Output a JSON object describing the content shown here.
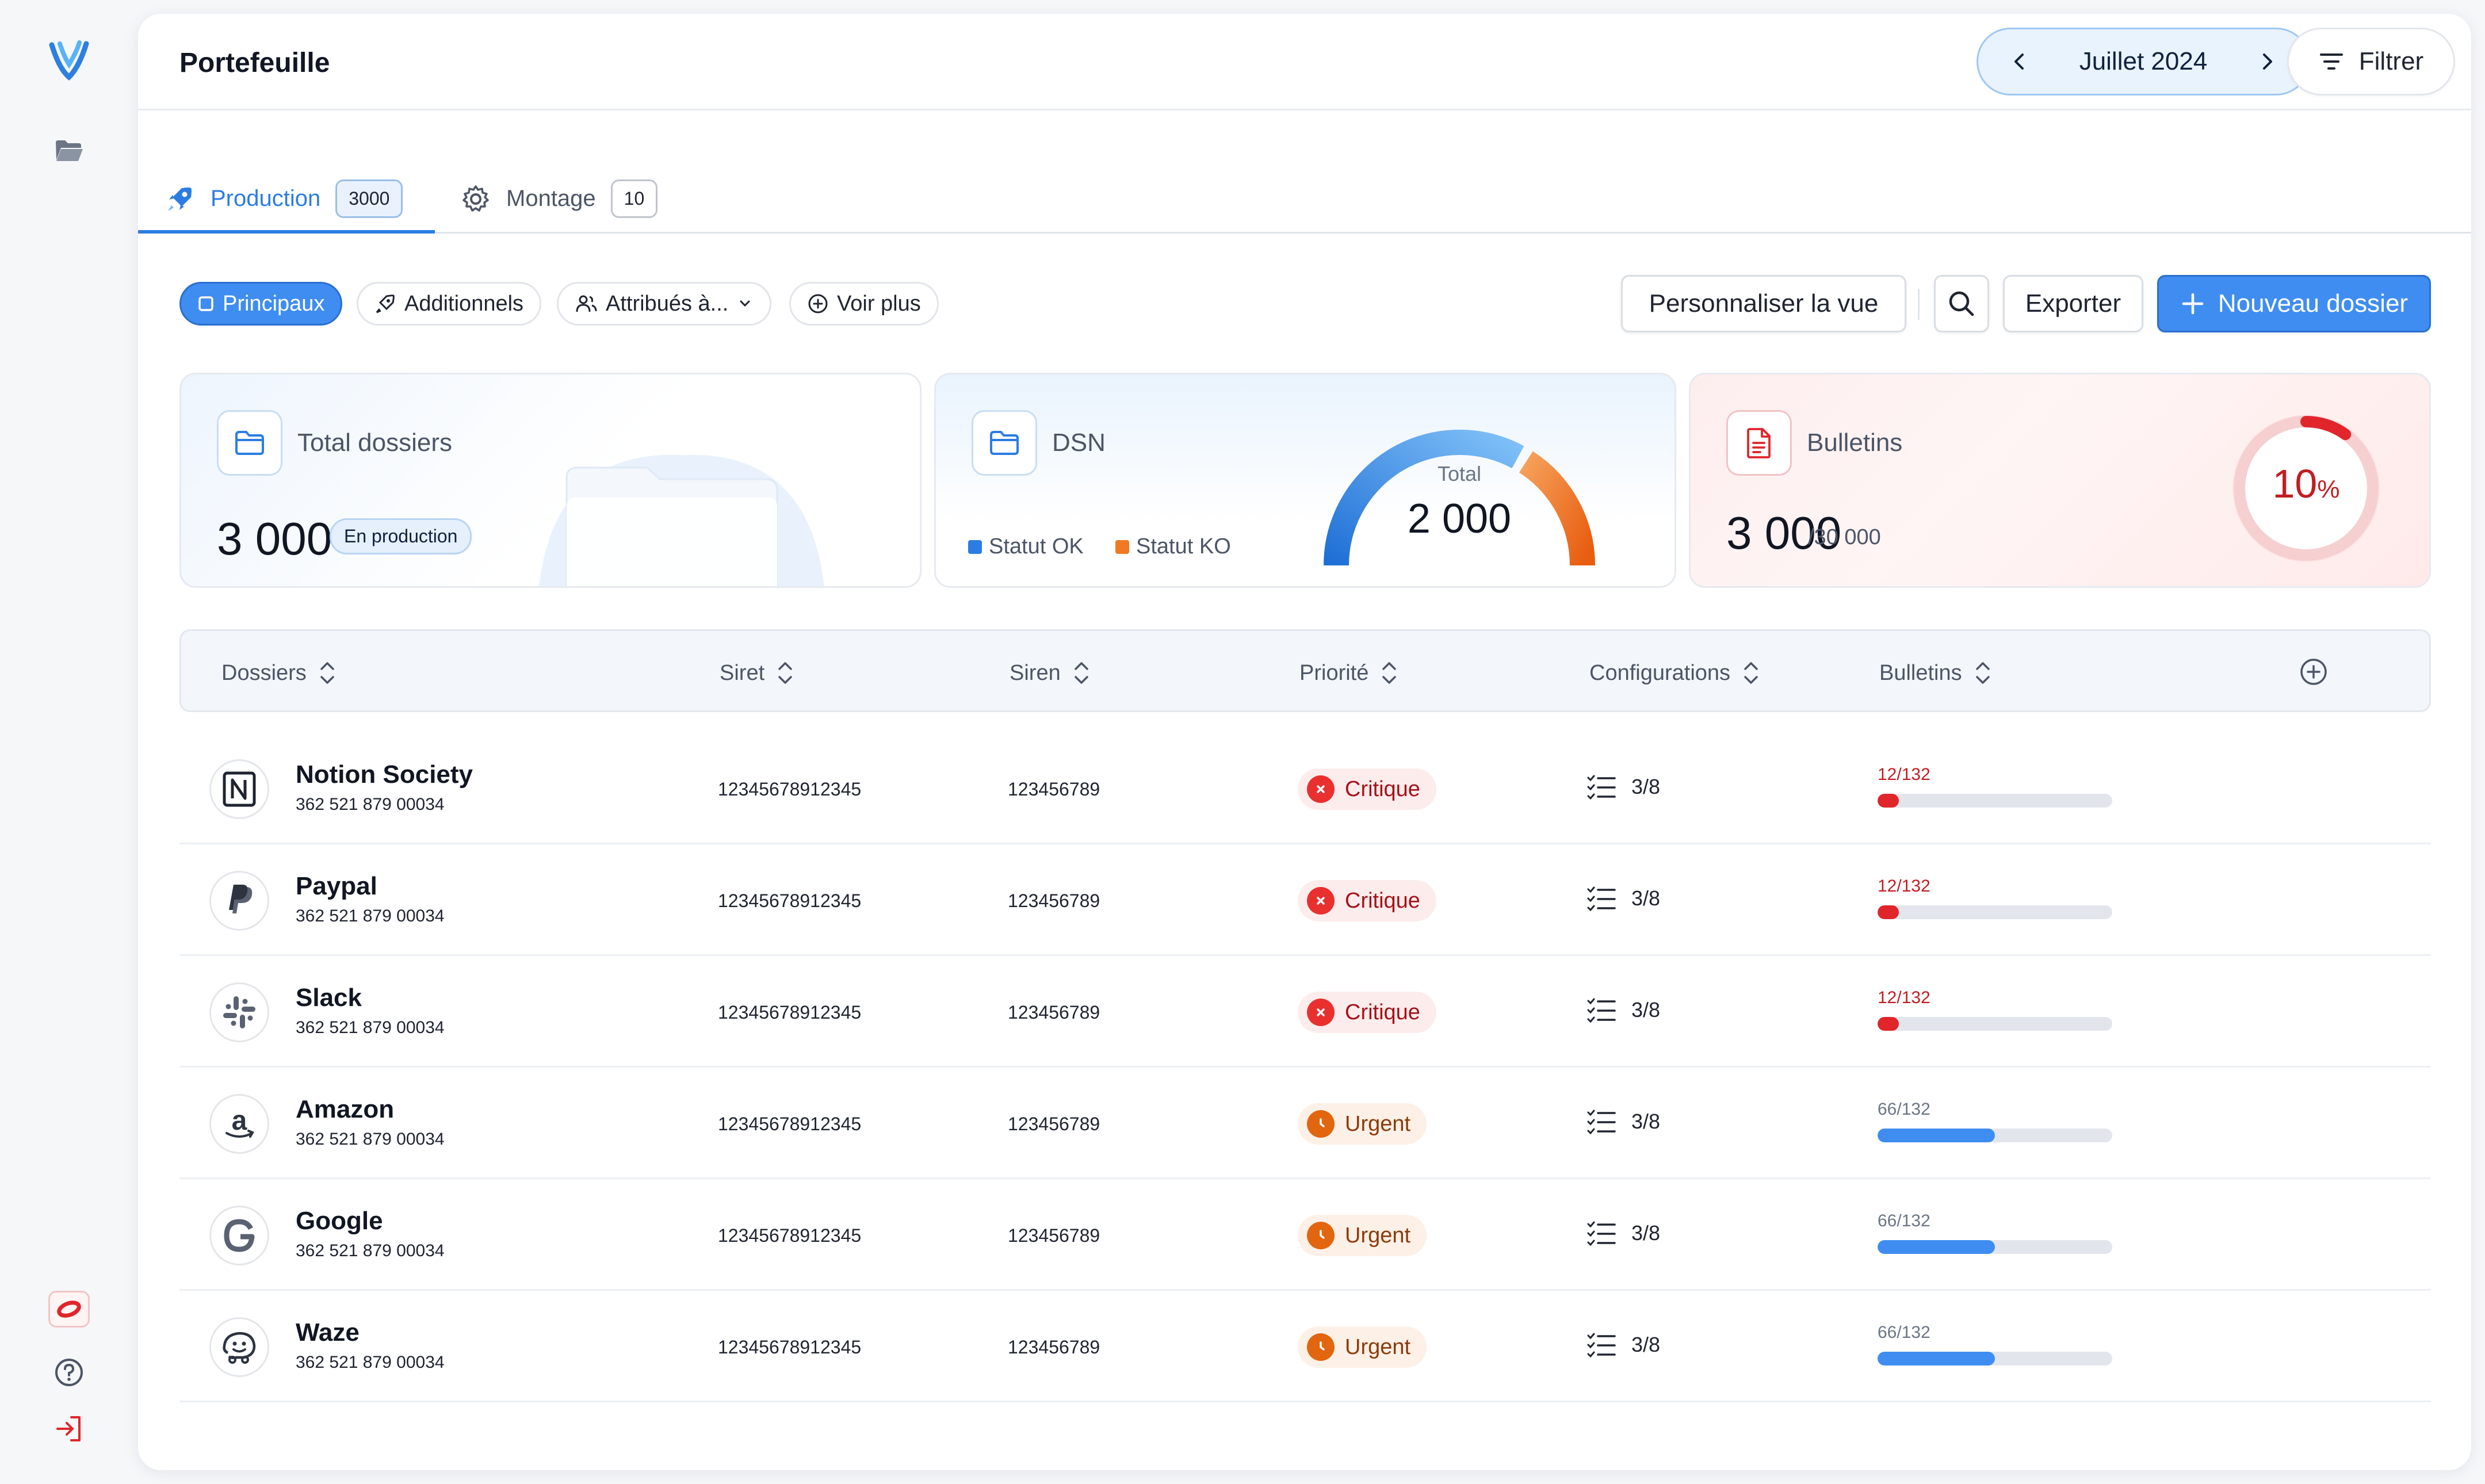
{
  "app": {
    "title": "Portefeuille"
  },
  "period": {
    "label": "Juillet 2024"
  },
  "filter_label": "Filtrer",
  "tabs": [
    {
      "label": "Production",
      "count": "3000"
    },
    {
      "label": "Montage",
      "count": "10"
    }
  ],
  "chips": {
    "principaux": "Principaux",
    "additionnels": "Additionnels",
    "attribues": "Attribués à...",
    "voir_plus": "Voir plus"
  },
  "actions": {
    "personnaliser": "Personnaliser la vue",
    "exporter": "Exporter",
    "nouveau": "Nouveau dossier"
  },
  "stats": {
    "total": {
      "title": "Total dossiers",
      "value": "3 000",
      "tag": "En production"
    },
    "dsn": {
      "title": "DSN",
      "legend_ok": "Statut OK",
      "legend_ko": "Statut KO",
      "gauge_label": "Total",
      "gauge_value": "2 000",
      "ok_fraction": 0.67
    },
    "bulletins": {
      "title": "Bulletins",
      "value": "3 000",
      "of": "/30 000",
      "percent": "10",
      "percent_sign": "%",
      "fraction": 0.1
    }
  },
  "table": {
    "headers": [
      "Dossiers",
      "Siret",
      "Siren",
      "Priorité",
      "Configurations",
      "Bulletins"
    ],
    "rows": [
      {
        "name": "Notion Society",
        "sub": "362 521 879 00034",
        "siret": "12345678912345",
        "siren": "123456789",
        "priority": "Critique",
        "level": "crit",
        "config": "3/8",
        "bulletins": "12/132",
        "done": 12,
        "total": 132,
        "logo": "N"
      },
      {
        "name": "Paypal",
        "sub": "362 521 879 00034",
        "siret": "12345678912345",
        "siren": "123456789",
        "priority": "Critique",
        "level": "crit",
        "config": "3/8",
        "bulletins": "12/132",
        "done": 12,
        "total": 132,
        "logo": "P"
      },
      {
        "name": "Slack",
        "sub": "362 521 879 00034",
        "siret": "12345678912345",
        "siren": "123456789",
        "priority": "Critique",
        "level": "crit",
        "config": "3/8",
        "bulletins": "12/132",
        "done": 12,
        "total": 132,
        "logo": "#"
      },
      {
        "name": "Amazon",
        "sub": "362 521 879 00034",
        "siret": "12345678912345",
        "siren": "123456789",
        "priority": "Urgent",
        "level": "urg",
        "config": "3/8",
        "bulletins": "66/132",
        "done": 66,
        "total": 132,
        "logo": "a"
      },
      {
        "name": "Google",
        "sub": "362 521 879 00034",
        "siret": "12345678912345",
        "siren": "123456789",
        "priority": "Urgent",
        "level": "urg",
        "config": "3/8",
        "bulletins": "66/132",
        "done": 66,
        "total": 132,
        "logo": "G"
      },
      {
        "name": "Waze",
        "sub": "362 521 879 00034",
        "siret": "12345678912345",
        "siren": "123456789",
        "priority": "Urgent",
        "level": "urg",
        "config": "3/8",
        "bulletins": "66/132",
        "done": 66,
        "total": 132,
        "logo": "w"
      }
    ]
  },
  "colors": {
    "accent": "#3f8df0",
    "critical": "#e0262b",
    "urgent": "#e2650f",
    "progress_ok": "#3f8df0",
    "progress_crit": "#e0262b",
    "gauge_ko": "#f07a24"
  }
}
